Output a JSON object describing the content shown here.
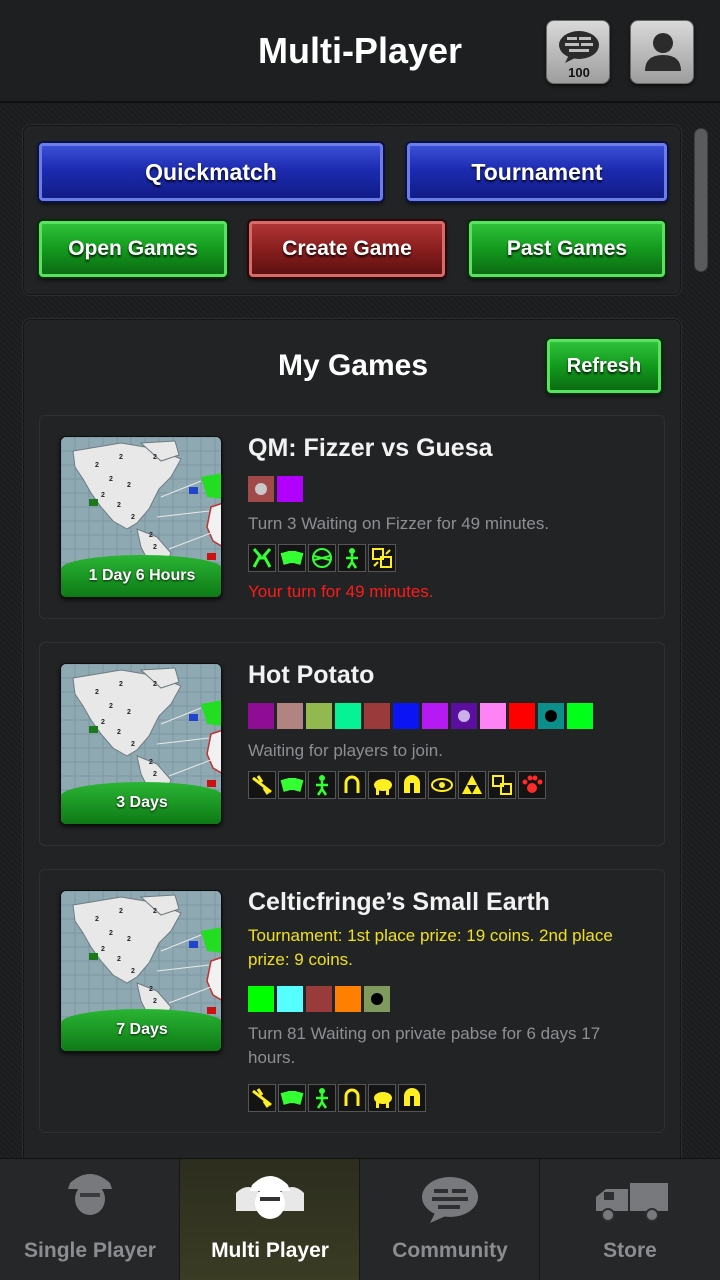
{
  "header": {
    "title": "Multi-Player",
    "message_count": "100"
  },
  "actions": {
    "quickmatch": "Quickmatch",
    "tournament": "Tournament",
    "open_games": "Open Games",
    "create_game": "Create Game",
    "past_games": "Past Games"
  },
  "my_games": {
    "title": "My Games",
    "refresh": "Refresh",
    "games": [
      {
        "title": "QM: Fizzer vs Guesa",
        "time_left": "1 Day 6 Hours",
        "colors": [
          "#a24a4a",
          "#b200ff"
        ],
        "status": "Turn 3   Waiting on Fizzer for 49 minutes.",
        "alert": "Your turn for 49 minutes."
      },
      {
        "title": "Hot Potato",
        "time_left": "3 Days",
        "colors": [
          "#8e0d94",
          "#b28383",
          "#91b94f",
          "#05f395",
          "#9a3a3a",
          "#0a14f5",
          "#b61af2",
          "#5b0f9e",
          "#ff83f4",
          "#ff0000",
          "#0c8e8a",
          "#00ff19"
        ],
        "status": "Waiting for players to join."
      },
      {
        "title": "Celticfringe’s Small Earth",
        "time_left": "7 Days",
        "tournament": "Tournament: 1st place prize: 19 coins.  2nd place prize: 9 coins.",
        "colors": [
          "#00ff00",
          "#55ffff",
          "#9a3b3b",
          "#ff8000",
          "#7f9a5c"
        ],
        "status": "Turn 81  Waiting on private pabse for 6 days 17 hours."
      }
    ]
  },
  "bottom_nav": {
    "single_player": "Single Player",
    "multi_player": "Multi Player",
    "community": "Community",
    "store": "Store"
  }
}
